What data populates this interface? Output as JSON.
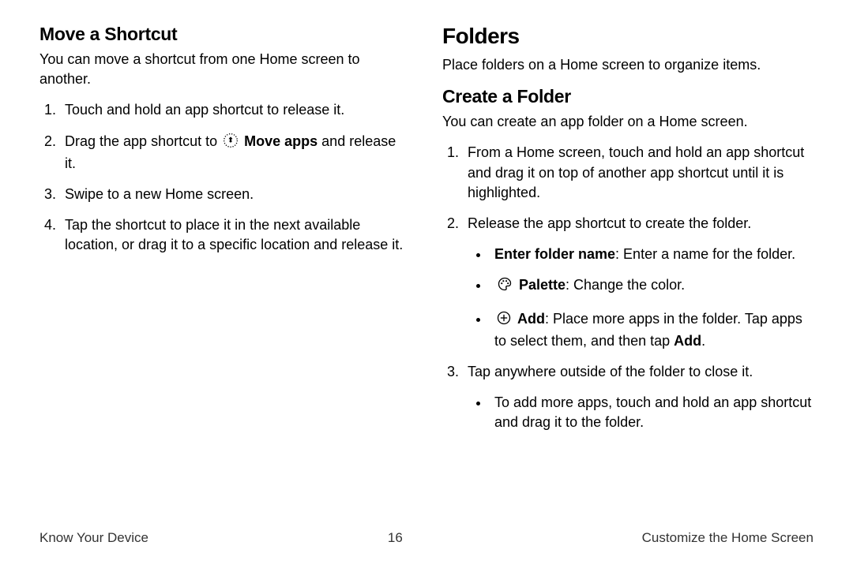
{
  "left": {
    "h2": "Move a Shortcut",
    "intro": "You can move a shortcut from one Home screen to another.",
    "step1": "Touch and hold an app shortcut to release it.",
    "step2_a": "Drag the app shortcut to ",
    "step2_bold": "Move apps",
    "step2_b": " and release it.",
    "step3": "Swipe to a new Home screen.",
    "step4": "Tap the shortcut to place it in the next available location, or drag it to a specific location and release it."
  },
  "right": {
    "h1": "Folders",
    "intro": "Place folders on a Home screen to organize items.",
    "h2": "Create a Folder",
    "sub_intro": "You can create an app folder on a Home screen.",
    "step1": "From a Home screen, touch and hold an app shortcut and drag it on top of another app shortcut until it is highlighted.",
    "step2": "Release the app shortcut to create the folder.",
    "b1_bold": "Enter folder name",
    "b1_rest": ": Enter a name for the folder.",
    "b2_bold": "Palette",
    "b2_rest": ": Change the color.",
    "b3_bold": "Add",
    "b3_rest_a": ": Place more apps in the folder. Tap apps to select them, and then tap ",
    "b3_rest_bold": "Add",
    "b3_rest_b": ".",
    "step3": "Tap anywhere outside of the folder to close it.",
    "step3_b1": "To add more apps, touch and hold an app shortcut and drag it to the folder."
  },
  "footer": {
    "left": "Know Your Device",
    "center": "16",
    "right": "Customize the Home Screen"
  }
}
